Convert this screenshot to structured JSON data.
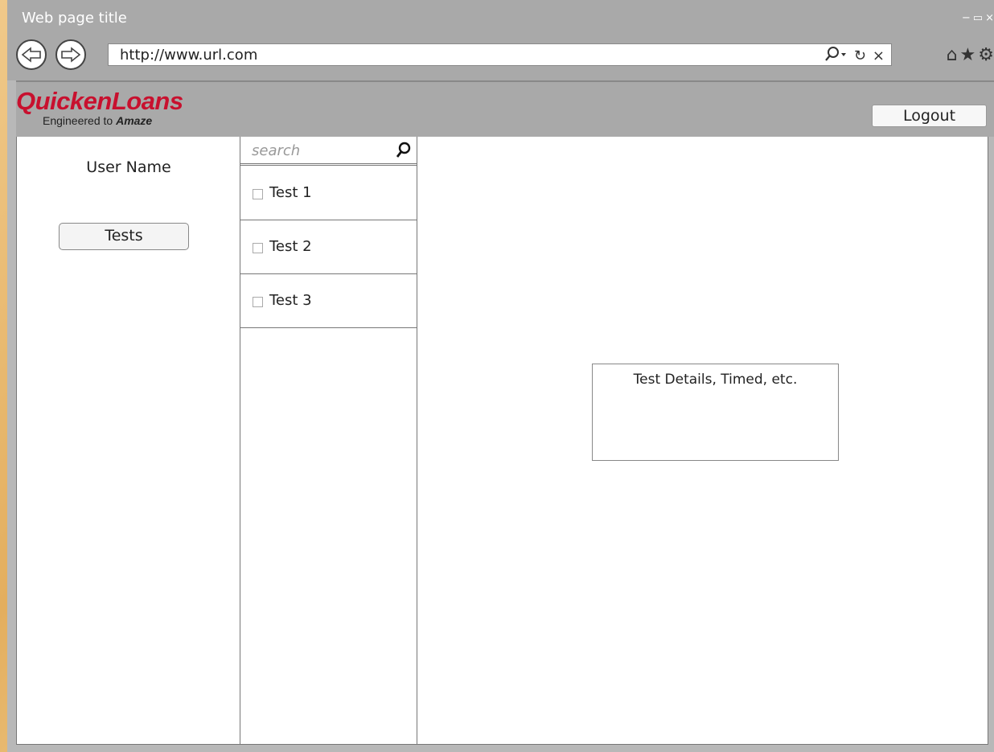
{
  "browser": {
    "window_title": "Web page title",
    "url": "http://www.url.com",
    "window_controls": [
      "_",
      "▭",
      "×"
    ],
    "url_tools": [
      "search-dropdown-icon",
      "refresh-icon",
      "stop-icon"
    ],
    "toolbar_icons": [
      "home-icon",
      "star-icon",
      "gear-icon"
    ]
  },
  "header": {
    "logo_main": "QuickenLoans",
    "logo_tagline_prefix": "Engineered to",
    "logo_tagline_emphasis": "Amaze",
    "logout_label": "Logout",
    "brand_color": "#c8102e"
  },
  "sidebar": {
    "user_name": "User Name",
    "tests_button_label": "Tests"
  },
  "test_list": {
    "search_placeholder": "search",
    "items": [
      {
        "label": "Test 1",
        "checked": false
      },
      {
        "label": "Test 2",
        "checked": false
      },
      {
        "label": "Test 3",
        "checked": false
      }
    ]
  },
  "details_panel": {
    "text": "Test Details, Timed, etc."
  }
}
